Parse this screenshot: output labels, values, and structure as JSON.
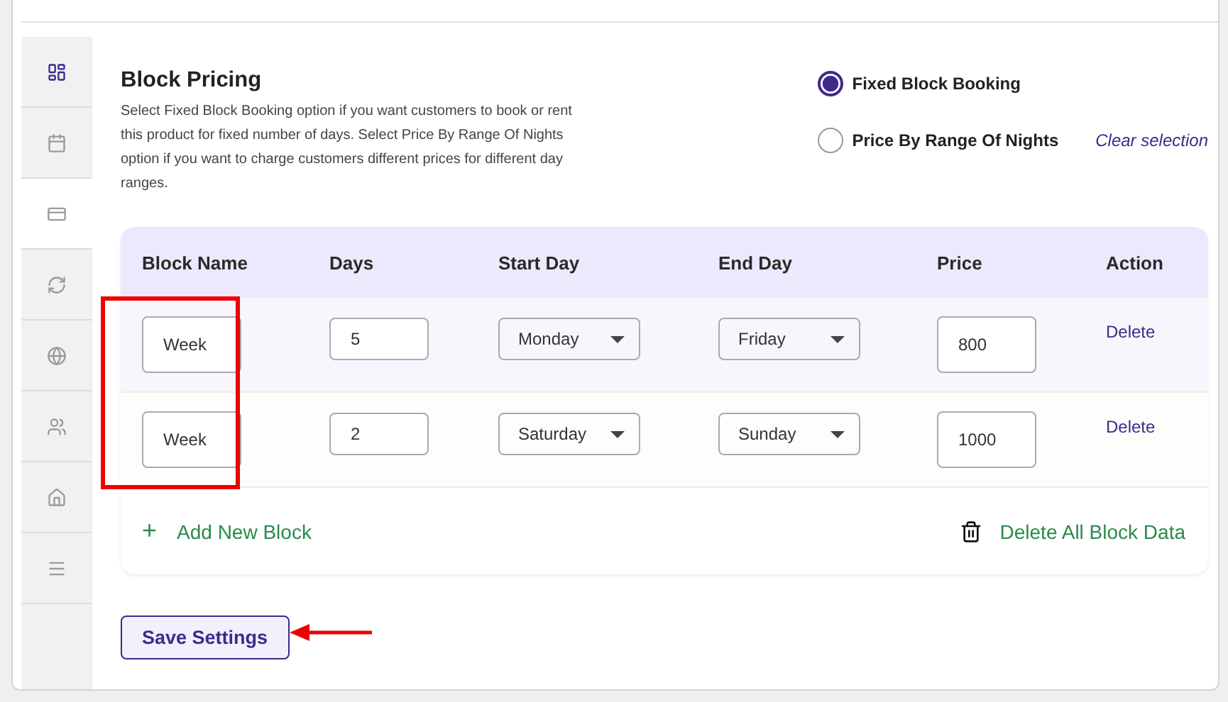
{
  "sidebar": {
    "items": [
      {
        "kind": "dashboard",
        "selected": false,
        "highlighted": true
      },
      {
        "kind": "calendar",
        "selected": false,
        "highlighted": false
      },
      {
        "kind": "card",
        "selected": true,
        "highlighted": false
      },
      {
        "kind": "sync",
        "selected": false,
        "highlighted": false
      },
      {
        "kind": "globe",
        "selected": false,
        "highlighted": false
      },
      {
        "kind": "people",
        "selected": false,
        "highlighted": false
      },
      {
        "kind": "home",
        "selected": false,
        "highlighted": false
      },
      {
        "kind": "list",
        "selected": false,
        "highlighted": false
      }
    ]
  },
  "section": {
    "title": "Block Pricing",
    "description": "Select Fixed Block Booking option if you want customers to book or rent this product for fixed number of days. Select Price By Range Of Nights option if you want to charge customers different prices for different day ranges."
  },
  "options": [
    {
      "label": "Fixed Block Booking",
      "selected": true
    },
    {
      "label": "Price By Range Of Nights",
      "selected": false
    }
  ],
  "clear_link": "Clear selection",
  "table": {
    "columns": [
      "Block Name",
      "Days",
      "Start Day",
      "End Day",
      "Price",
      "Action"
    ],
    "rows": [
      {
        "name": "Week",
        "days": "5",
        "start": "Monday",
        "end": "Friday",
        "price": "800",
        "action": "Delete"
      },
      {
        "name": "Week",
        "days": "2",
        "start": "Saturday",
        "end": "Sunday",
        "price": "1000",
        "action": "Delete"
      }
    ]
  },
  "add_label": "+",
  "add_text": "Add New Block",
  "delete_all": "Delete All Block Data",
  "save": "Save Settings"
}
